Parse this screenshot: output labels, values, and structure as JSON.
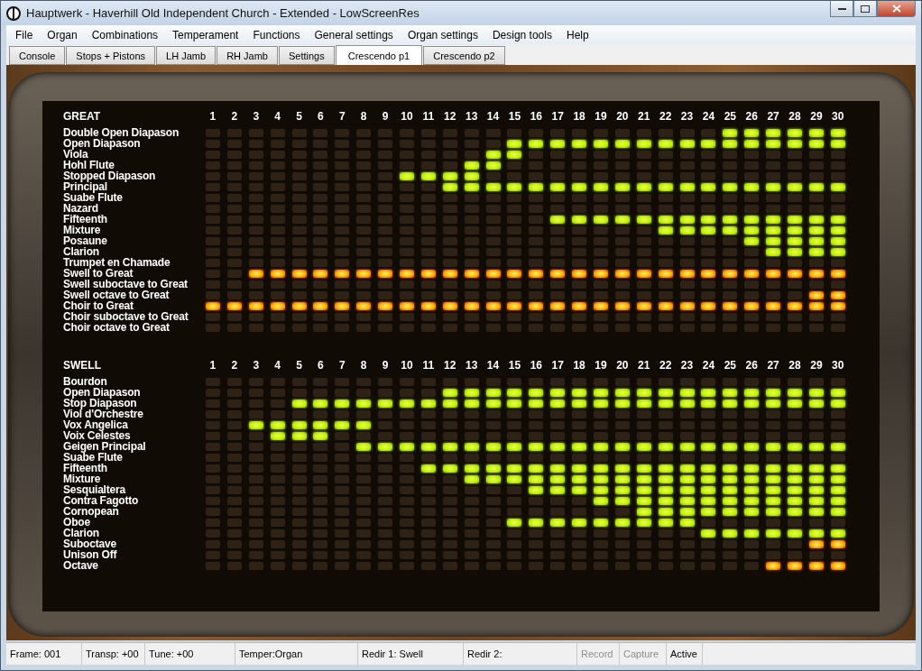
{
  "window": {
    "title": "Hauptwerk - Haverhill Old Independent Church - Extended - LowScreenRes"
  },
  "menu": [
    "File",
    "Organ",
    "Combinations",
    "Temperament",
    "Functions",
    "General settings",
    "Organ settings",
    "Design tools",
    "Help"
  ],
  "tabs": [
    {
      "label": "Console",
      "selected": false
    },
    {
      "label": "Stops + Pistons",
      "selected": false
    },
    {
      "label": "LH Jamb",
      "selected": false
    },
    {
      "label": "RH Jamb",
      "selected": false
    },
    {
      "label": "Settings",
      "selected": false
    },
    {
      "label": "Crescendo p1",
      "selected": true
    },
    {
      "label": "Crescendo p2",
      "selected": false
    }
  ],
  "sections": [
    {
      "title": "GREAT",
      "columns": [
        "1",
        "2",
        "3",
        "4",
        "5",
        "6",
        "7",
        "8",
        "9",
        "10",
        "11",
        "12",
        "13",
        "14",
        "15",
        "16",
        "17",
        "18",
        "19",
        "20",
        "21",
        "22",
        "23",
        "24",
        "25",
        "26",
        "27",
        "28",
        "29",
        "30"
      ],
      "rows": [
        {
          "name": "Double Open Diapason",
          "kind": "stop",
          "lit": [
            false,
            false,
            false,
            false,
            false,
            false,
            false,
            false,
            false,
            false,
            false,
            false,
            false,
            false,
            false,
            false,
            false,
            false,
            false,
            false,
            false,
            false,
            false,
            false,
            true,
            true,
            true,
            true,
            true,
            true
          ]
        },
        {
          "name": "Open Diapason",
          "kind": "stop",
          "lit": [
            false,
            false,
            false,
            false,
            false,
            false,
            false,
            false,
            false,
            false,
            false,
            false,
            false,
            false,
            true,
            true,
            true,
            true,
            true,
            true,
            true,
            true,
            true,
            true,
            true,
            true,
            true,
            true,
            true,
            true
          ]
        },
        {
          "name": "Viola",
          "kind": "stop",
          "lit": [
            false,
            false,
            false,
            false,
            false,
            false,
            false,
            false,
            false,
            false,
            false,
            false,
            false,
            true,
            true,
            false,
            false,
            false,
            false,
            false,
            false,
            false,
            false,
            false,
            false,
            false,
            false,
            false,
            false,
            false
          ]
        },
        {
          "name": "Hohl Flute",
          "kind": "stop",
          "lit": [
            false,
            false,
            false,
            false,
            false,
            false,
            false,
            false,
            false,
            false,
            false,
            false,
            true,
            true,
            false,
            false,
            false,
            false,
            false,
            false,
            false,
            false,
            false,
            false,
            false,
            false,
            false,
            false,
            false,
            false
          ]
        },
        {
          "name": "Stopped Diapason",
          "kind": "stop",
          "lit": [
            false,
            false,
            false,
            false,
            false,
            false,
            false,
            false,
            false,
            true,
            true,
            true,
            true,
            false,
            false,
            false,
            false,
            false,
            false,
            false,
            false,
            false,
            false,
            false,
            false,
            false,
            false,
            false,
            false,
            false
          ]
        },
        {
          "name": "Principal",
          "kind": "stop",
          "lit": [
            false,
            false,
            false,
            false,
            false,
            false,
            false,
            false,
            false,
            false,
            false,
            true,
            true,
            true,
            true,
            true,
            true,
            true,
            true,
            true,
            true,
            true,
            true,
            true,
            true,
            true,
            true,
            true,
            true,
            true
          ]
        },
        {
          "name": "Suabe Flute",
          "lit": [
            false,
            false,
            false,
            false,
            false,
            false,
            false,
            false,
            false,
            false,
            false,
            false,
            false,
            false,
            false,
            false,
            false,
            false,
            false,
            false,
            false,
            false,
            false,
            false,
            false,
            false,
            false,
            false,
            false,
            false
          ]
        },
        {
          "name": "Nazard",
          "lit": [
            false,
            false,
            false,
            false,
            false,
            false,
            false,
            false,
            false,
            false,
            false,
            false,
            false,
            false,
            false,
            false,
            false,
            false,
            false,
            false,
            false,
            false,
            false,
            false,
            false,
            false,
            false,
            false,
            false,
            false
          ]
        },
        {
          "name": "Fifteenth",
          "kind": "stop",
          "lit": [
            false,
            false,
            false,
            false,
            false,
            false,
            false,
            false,
            false,
            false,
            false,
            false,
            false,
            false,
            false,
            false,
            true,
            true,
            true,
            true,
            true,
            true,
            true,
            true,
            true,
            true,
            true,
            true,
            true,
            true
          ]
        },
        {
          "name": "Mixture",
          "kind": "stop",
          "lit": [
            false,
            false,
            false,
            false,
            false,
            false,
            false,
            false,
            false,
            false,
            false,
            false,
            false,
            false,
            false,
            false,
            false,
            false,
            false,
            false,
            false,
            true,
            true,
            true,
            true,
            true,
            true,
            true,
            true,
            true
          ]
        },
        {
          "name": "Posaune",
          "kind": "stop",
          "lit": [
            false,
            false,
            false,
            false,
            false,
            false,
            false,
            false,
            false,
            false,
            false,
            false,
            false,
            false,
            false,
            false,
            false,
            false,
            false,
            false,
            false,
            false,
            false,
            false,
            false,
            true,
            true,
            true,
            true,
            true
          ]
        },
        {
          "name": "Clarion",
          "kind": "stop",
          "lit": [
            false,
            false,
            false,
            false,
            false,
            false,
            false,
            false,
            false,
            false,
            false,
            false,
            false,
            false,
            false,
            false,
            false,
            false,
            false,
            false,
            false,
            false,
            false,
            false,
            false,
            false,
            true,
            true,
            true,
            true
          ]
        },
        {
          "name": "Trumpet en Chamade",
          "lit": [
            false,
            false,
            false,
            false,
            false,
            false,
            false,
            false,
            false,
            false,
            false,
            false,
            false,
            false,
            false,
            false,
            false,
            false,
            false,
            false,
            false,
            false,
            false,
            false,
            false,
            false,
            false,
            false,
            false,
            false
          ]
        },
        {
          "name": "Swell to Great",
          "kind": "coupler",
          "lit": [
            false,
            false,
            true,
            true,
            true,
            true,
            true,
            true,
            true,
            true,
            true,
            true,
            true,
            true,
            true,
            true,
            true,
            true,
            true,
            true,
            true,
            true,
            true,
            true,
            true,
            true,
            true,
            true,
            true,
            true
          ]
        },
        {
          "name": "Swell suboctave to Great",
          "lit": [
            false,
            false,
            false,
            false,
            false,
            false,
            false,
            false,
            false,
            false,
            false,
            false,
            false,
            false,
            false,
            false,
            false,
            false,
            false,
            false,
            false,
            false,
            false,
            false,
            false,
            false,
            false,
            false,
            false,
            false
          ]
        },
        {
          "name": "Swell octave to Great",
          "kind": "coupler",
          "lit": [
            false,
            false,
            false,
            false,
            false,
            false,
            false,
            false,
            false,
            false,
            false,
            false,
            false,
            false,
            false,
            false,
            false,
            false,
            false,
            false,
            false,
            false,
            false,
            false,
            false,
            false,
            false,
            false,
            true,
            true
          ]
        },
        {
          "name": "Choir to Great",
          "kind": "coupler",
          "lit": [
            true,
            true,
            true,
            true,
            true,
            true,
            true,
            true,
            true,
            true,
            true,
            true,
            true,
            true,
            true,
            true,
            true,
            true,
            true,
            true,
            true,
            true,
            true,
            true,
            true,
            true,
            true,
            true,
            true,
            true
          ]
        },
        {
          "name": "Choir suboctave to Great",
          "lit": [
            false,
            false,
            false,
            false,
            false,
            false,
            false,
            false,
            false,
            false,
            false,
            false,
            false,
            false,
            false,
            false,
            false,
            false,
            false,
            false,
            false,
            false,
            false,
            false,
            false,
            false,
            false,
            false,
            false,
            false
          ]
        },
        {
          "name": "Choir octave to Great",
          "lit": [
            false,
            false,
            false,
            false,
            false,
            false,
            false,
            false,
            false,
            false,
            false,
            false,
            false,
            false,
            false,
            false,
            false,
            false,
            false,
            false,
            false,
            false,
            false,
            false,
            false,
            false,
            false,
            false,
            false,
            false
          ]
        }
      ]
    },
    {
      "title": "SWELL",
      "columns": [
        "1",
        "2",
        "3",
        "4",
        "5",
        "6",
        "7",
        "8",
        "9",
        "10",
        "11",
        "12",
        "13",
        "14",
        "15",
        "16",
        "17",
        "18",
        "19",
        "20",
        "21",
        "22",
        "23",
        "24",
        "25",
        "26",
        "27",
        "28",
        "29",
        "30"
      ],
      "rows": [
        {
          "name": "Bourdon",
          "lit": [
            false,
            false,
            false,
            false,
            false,
            false,
            false,
            false,
            false,
            false,
            false,
            false,
            false,
            false,
            false,
            false,
            false,
            false,
            false,
            false,
            false,
            false,
            false,
            false,
            false,
            false,
            false,
            false,
            false,
            false
          ]
        },
        {
          "name": "Open Diapason",
          "kind": "stop",
          "lit": [
            false,
            false,
            false,
            false,
            false,
            false,
            false,
            false,
            false,
            false,
            false,
            true,
            true,
            true,
            true,
            true,
            true,
            true,
            true,
            true,
            true,
            true,
            true,
            true,
            true,
            true,
            true,
            true,
            true,
            true
          ]
        },
        {
          "name": "Stop Diapason",
          "kind": "stop",
          "lit": [
            false,
            false,
            false,
            false,
            true,
            true,
            true,
            true,
            true,
            true,
            true,
            true,
            true,
            true,
            true,
            true,
            true,
            true,
            true,
            true,
            true,
            true,
            true,
            true,
            true,
            true,
            true,
            true,
            true,
            true
          ]
        },
        {
          "name": "Viol d'Orchestre",
          "lit": [
            false,
            false,
            false,
            false,
            false,
            false,
            false,
            false,
            false,
            false,
            false,
            false,
            false,
            false,
            false,
            false,
            false,
            false,
            false,
            false,
            false,
            false,
            false,
            false,
            false,
            false,
            false,
            false,
            false,
            false
          ]
        },
        {
          "name": "Vox Angelica",
          "kind": "stop",
          "lit": [
            false,
            false,
            true,
            true,
            true,
            true,
            true,
            true,
            false,
            false,
            false,
            false,
            false,
            false,
            false,
            false,
            false,
            false,
            false,
            false,
            false,
            false,
            false,
            false,
            false,
            false,
            false,
            false,
            false,
            false
          ]
        },
        {
          "name": "Voix Celestes",
          "kind": "stop",
          "lit": [
            false,
            false,
            false,
            true,
            true,
            true,
            false,
            false,
            false,
            false,
            false,
            false,
            false,
            false,
            false,
            false,
            false,
            false,
            false,
            false,
            false,
            false,
            false,
            false,
            false,
            false,
            false,
            false,
            false,
            false
          ]
        },
        {
          "name": "Geigen Principal",
          "kind": "stop",
          "lit": [
            false,
            false,
            false,
            false,
            false,
            false,
            false,
            true,
            true,
            true,
            true,
            true,
            true,
            true,
            true,
            true,
            true,
            true,
            true,
            true,
            true,
            true,
            true,
            true,
            true,
            true,
            true,
            true,
            true,
            true
          ]
        },
        {
          "name": "Suabe Flute",
          "lit": [
            false,
            false,
            false,
            false,
            false,
            false,
            false,
            false,
            false,
            false,
            false,
            false,
            false,
            false,
            false,
            false,
            false,
            false,
            false,
            false,
            false,
            false,
            false,
            false,
            false,
            false,
            false,
            false,
            false,
            false
          ]
        },
        {
          "name": "Fifteenth",
          "kind": "stop",
          "lit": [
            false,
            false,
            false,
            false,
            false,
            false,
            false,
            false,
            false,
            false,
            true,
            true,
            true,
            true,
            true,
            true,
            true,
            true,
            true,
            true,
            true,
            true,
            true,
            true,
            true,
            true,
            true,
            true,
            true,
            true
          ]
        },
        {
          "name": "Mixture",
          "kind": "stop",
          "lit": [
            false,
            false,
            false,
            false,
            false,
            false,
            false,
            false,
            false,
            false,
            false,
            false,
            true,
            true,
            true,
            true,
            true,
            true,
            true,
            true,
            true,
            true,
            true,
            true,
            true,
            true,
            true,
            true,
            true,
            true
          ]
        },
        {
          "name": "Sesquialtera",
          "kind": "stop",
          "lit": [
            false,
            false,
            false,
            false,
            false,
            false,
            false,
            false,
            false,
            false,
            false,
            false,
            false,
            false,
            false,
            true,
            true,
            true,
            true,
            true,
            true,
            true,
            true,
            true,
            true,
            true,
            true,
            true,
            true,
            true
          ]
        },
        {
          "name": "Contra Fagotto",
          "kind": "stop",
          "lit": [
            false,
            false,
            false,
            false,
            false,
            false,
            false,
            false,
            false,
            false,
            false,
            false,
            false,
            false,
            false,
            false,
            false,
            false,
            true,
            true,
            true,
            true,
            true,
            true,
            true,
            true,
            true,
            true,
            true,
            true
          ]
        },
        {
          "name": "Cornopean",
          "kind": "stop",
          "lit": [
            false,
            false,
            false,
            false,
            false,
            false,
            false,
            false,
            false,
            false,
            false,
            false,
            false,
            false,
            false,
            false,
            false,
            false,
            false,
            false,
            true,
            true,
            true,
            true,
            true,
            true,
            true,
            true,
            true,
            true
          ]
        },
        {
          "name": "Oboe",
          "kind": "stop",
          "lit": [
            false,
            false,
            false,
            false,
            false,
            false,
            false,
            false,
            false,
            false,
            false,
            false,
            false,
            false,
            true,
            true,
            true,
            true,
            true,
            true,
            true,
            true,
            true,
            false,
            false,
            false,
            false,
            false,
            false,
            false
          ]
        },
        {
          "name": "Clarion",
          "kind": "stop",
          "lit": [
            false,
            false,
            false,
            false,
            false,
            false,
            false,
            false,
            false,
            false,
            false,
            false,
            false,
            false,
            false,
            false,
            false,
            false,
            false,
            false,
            false,
            false,
            false,
            true,
            true,
            true,
            true,
            true,
            true,
            true
          ]
        },
        {
          "name": "Suboctave",
          "kind": "coupler",
          "lit": [
            false,
            false,
            false,
            false,
            false,
            false,
            false,
            false,
            false,
            false,
            false,
            false,
            false,
            false,
            false,
            false,
            false,
            false,
            false,
            false,
            false,
            false,
            false,
            false,
            false,
            false,
            false,
            false,
            true,
            true
          ]
        },
        {
          "name": "Unison Off",
          "lit": [
            false,
            false,
            false,
            false,
            false,
            false,
            false,
            false,
            false,
            false,
            false,
            false,
            false,
            false,
            false,
            false,
            false,
            false,
            false,
            false,
            false,
            false,
            false,
            false,
            false,
            false,
            false,
            false,
            false,
            false
          ]
        },
        {
          "name": "Octave",
          "kind": "coupler",
          "lit": [
            false,
            false,
            false,
            false,
            false,
            false,
            false,
            false,
            false,
            false,
            false,
            false,
            false,
            false,
            false,
            false,
            false,
            false,
            false,
            false,
            false,
            false,
            false,
            false,
            false,
            false,
            true,
            true,
            true,
            true
          ]
        }
      ]
    }
  ],
  "status_bar": [
    {
      "text": "Frame: 001",
      "disabled": false
    },
    {
      "text": "Transp: +00",
      "disabled": false
    },
    {
      "text": "Tune: +00",
      "disabled": false
    },
    {
      "text": "Temper:Organ",
      "disabled": false
    },
    {
      "text": "Redir 1: Swell",
      "disabled": false
    },
    {
      "text": "Redir 2:",
      "disabled": false
    },
    {
      "text": "Record",
      "disabled": true
    },
    {
      "text": "Capture",
      "disabled": true
    },
    {
      "text": "Active",
      "disabled": false
    }
  ]
}
